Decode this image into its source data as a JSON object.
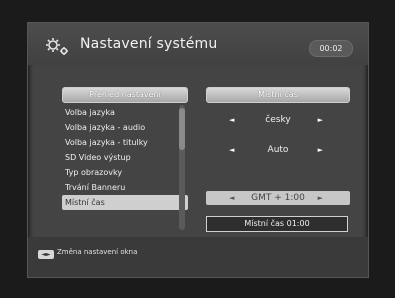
{
  "window": {
    "title": "Nastavení systému",
    "clock": "00:02",
    "icon": "gear-icon"
  },
  "left_panel": {
    "header": "Přehled nastavení",
    "items": [
      {
        "label": "Volba jazyka",
        "selected": false
      },
      {
        "label": "Volba jazyka - audio",
        "selected": false
      },
      {
        "label": "Volba jazyka - titulky",
        "selected": false
      },
      {
        "label": "SD Video výstup",
        "selected": false
      },
      {
        "label": "Typ obrazovky",
        "selected": false
      },
      {
        "label": "Trvání Banneru",
        "selected": false
      },
      {
        "label": "Místní čas",
        "selected": true
      }
    ]
  },
  "right_panel": {
    "header": "Místní čas",
    "options": [
      {
        "value": "česky",
        "selected": false
      },
      {
        "value": "Auto",
        "selected": false
      },
      {
        "value": "GMT + 1:00",
        "selected": true
      }
    ],
    "info": "Místní čas 01:00"
  },
  "footer": {
    "key_icon": "left-right-keys-icon",
    "key_label": "◄►",
    "hint": "Změna nastavení okna"
  },
  "colors": {
    "background": "#444444",
    "highlight": "#cfcfcf",
    "header_gradient": "#c0c0c0"
  }
}
